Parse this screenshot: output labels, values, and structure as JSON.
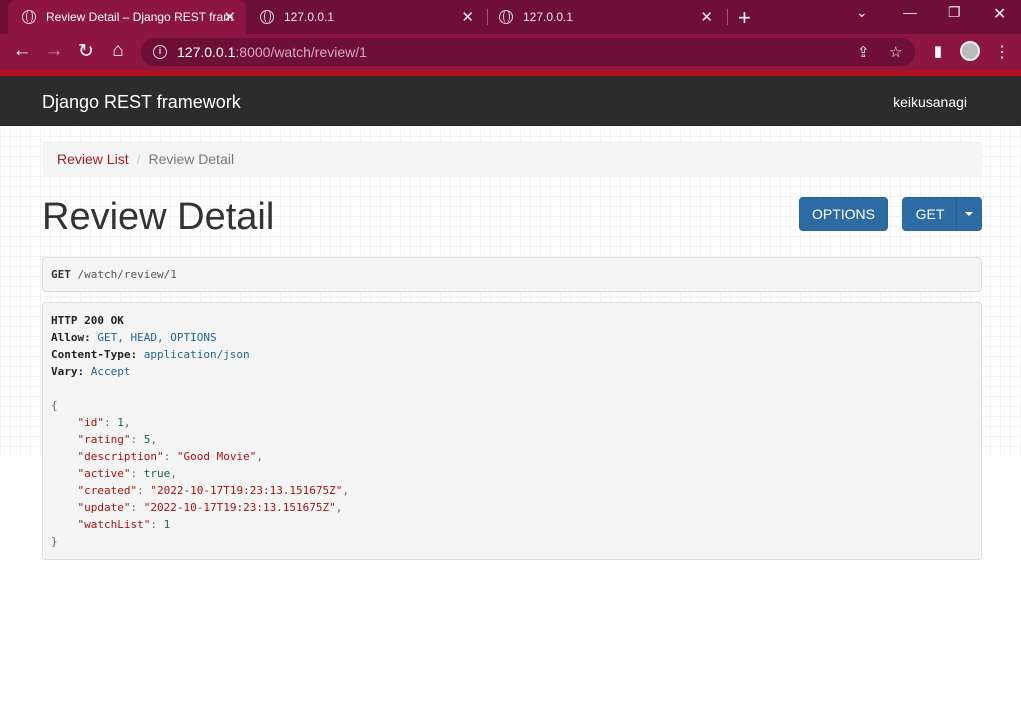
{
  "browser": {
    "tabs": [
      {
        "title": "Review Detail – Django REST fram",
        "active": true
      },
      {
        "title": "127.0.0.1",
        "active": false
      },
      {
        "title": "127.0.0.1",
        "active": false
      }
    ],
    "url_host": "127.0.0.1",
    "url_path": ":8000/watch/review/1",
    "theme_color": "#8c1541"
  },
  "navbar": {
    "brand": "Django REST framework",
    "user": "keikusanagi"
  },
  "breadcrumb": {
    "link": "Review List",
    "separator": "/",
    "current": "Review Detail"
  },
  "page": {
    "title": "Review Detail",
    "options_button": "OPTIONS",
    "get_button": "GET"
  },
  "request": {
    "method": "GET",
    "path": "/watch/review/1"
  },
  "response": {
    "status": "HTTP 200 OK",
    "headers": [
      {
        "name": "Allow:",
        "value": "GET, HEAD, OPTIONS"
      },
      {
        "name": "Content-Type:",
        "value": "application/json"
      },
      {
        "name": "Vary:",
        "value": "Accept"
      }
    ],
    "open_brace": "{",
    "close_brace": "}",
    "body": [
      {
        "key": "\"id\"",
        "value": "1",
        "kind": "num",
        "comma": ","
      },
      {
        "key": "\"rating\"",
        "value": "5",
        "kind": "num",
        "comma": ","
      },
      {
        "key": "\"description\"",
        "value": "\"Good Movie\"",
        "kind": "str",
        "comma": ","
      },
      {
        "key": "\"active\"",
        "value": "true",
        "kind": "lit",
        "comma": ","
      },
      {
        "key": "\"created\"",
        "value": "\"2022-10-17T19:23:13.151675Z\"",
        "kind": "str",
        "comma": ","
      },
      {
        "key": "\"update\"",
        "value": "\"2022-10-17T19:23:13.151675Z\"",
        "kind": "str",
        "comma": ","
      },
      {
        "key": "\"watchList\"",
        "value": "1",
        "kind": "num",
        "comma": ""
      }
    ]
  }
}
